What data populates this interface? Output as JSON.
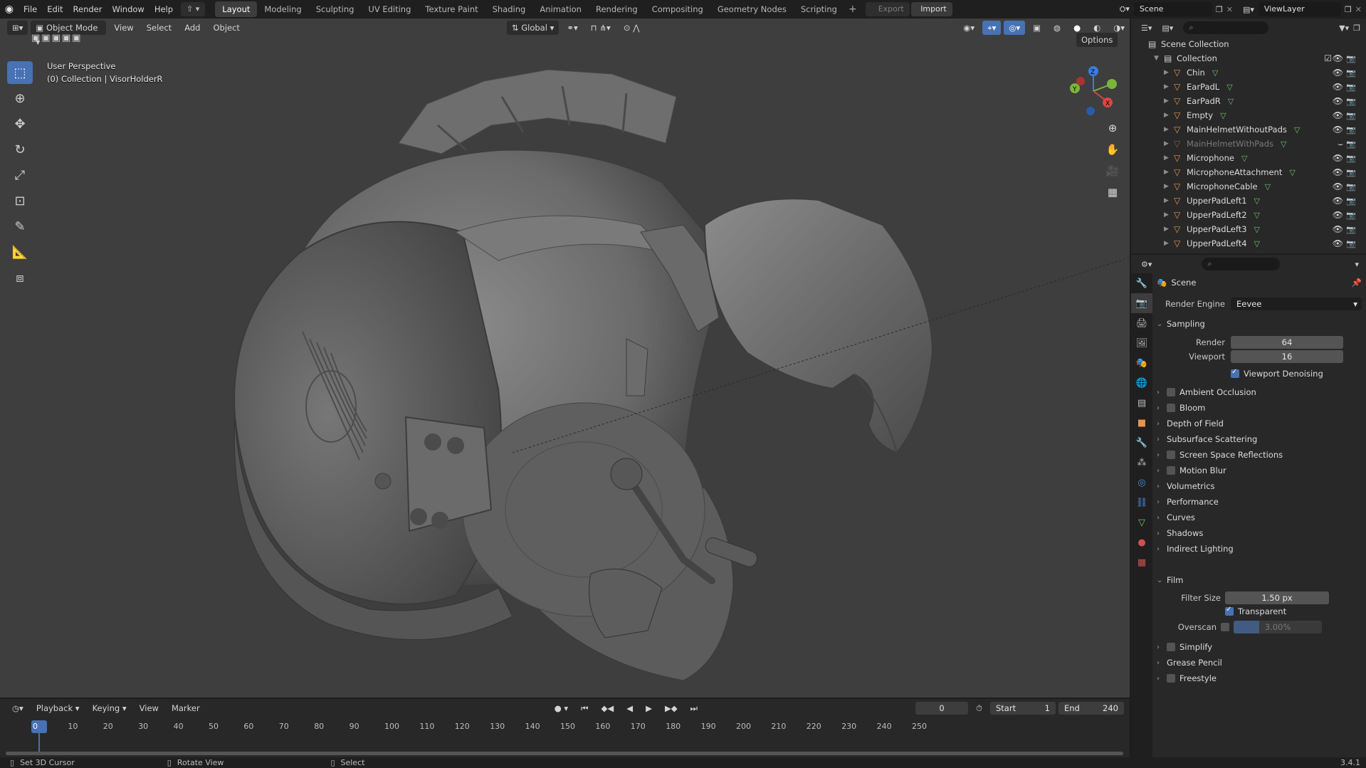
{
  "topbar": {
    "menus": [
      "File",
      "Edit",
      "Render",
      "Window",
      "Help"
    ],
    "workspaces": [
      "Layout",
      "Modeling",
      "Sculpting",
      "UV Editing",
      "Texture Paint",
      "Shading",
      "Animation",
      "Rendering",
      "Compositing",
      "Geometry Nodes",
      "Scripting"
    ],
    "active_workspace": "Layout",
    "export_label": "Export",
    "import_label": "Import",
    "scene_name": "Scene",
    "viewlayer_name": "ViewLayer"
  },
  "viewport": {
    "mode": "Object Mode",
    "menus": [
      "View",
      "Select",
      "Add",
      "Object"
    ],
    "orientation": "Global",
    "options_label": "Options",
    "perspective_label": "User Perspective",
    "collection_label": "(0) Collection | VisorHolderR",
    "gizmo": {
      "x": "X",
      "y": "Y",
      "z": "Z"
    }
  },
  "outliner": {
    "root": "Scene Collection",
    "collection": "Collection",
    "items": [
      {
        "name": "Chin",
        "dim": false
      },
      {
        "name": "EarPadL",
        "dim": false
      },
      {
        "name": "EarPadR",
        "dim": false
      },
      {
        "name": "Empty",
        "dim": false
      },
      {
        "name": "MainHelmetWithoutPads",
        "dim": false
      },
      {
        "name": "MainHelmetWithPads",
        "dim": true
      },
      {
        "name": "Microphone",
        "dim": false
      },
      {
        "name": "MicrophoneAttachment",
        "dim": false
      },
      {
        "name": "MicrophoneCable",
        "dim": false
      },
      {
        "name": "UpperPadLeft1",
        "dim": false
      },
      {
        "name": "UpperPadLeft2",
        "dim": false
      },
      {
        "name": "UpperPadLeft3",
        "dim": false
      },
      {
        "name": "UpperPadLeft4",
        "dim": false
      }
    ]
  },
  "properties": {
    "context": "Scene",
    "render_engine_label": "Render Engine",
    "render_engine": "Eevee",
    "sampling": {
      "label": "Sampling",
      "render_label": "Render",
      "render": "64",
      "viewport_label": "Viewport",
      "viewport": "16",
      "denoise_label": "Viewport Denoising"
    },
    "panels": [
      "Ambient Occlusion",
      "Bloom",
      "Depth of Field",
      "Subsurface Scattering",
      "Screen Space Reflections",
      "Motion Blur",
      "Volumetrics",
      "Performance",
      "Curves",
      "Shadows",
      "Indirect Lighting"
    ],
    "film": {
      "label": "Film",
      "filter_label": "Filter Size",
      "filter": "1.50 px",
      "transparent_label": "Transparent",
      "overscan_label": "Overscan",
      "overscan": "3.00%"
    },
    "bottom_panels": [
      "Simplify",
      "Grease Pencil",
      "Freestyle"
    ]
  },
  "timeline": {
    "menus": [
      "Playback",
      "Keying",
      "View",
      "Marker"
    ],
    "current_frame": "0",
    "start_label": "Start",
    "start": "1",
    "end_label": "End",
    "end": "240",
    "ticks": [
      "0",
      "10",
      "20",
      "30",
      "40",
      "50",
      "60",
      "70",
      "80",
      "90",
      "100",
      "110",
      "120",
      "130",
      "140",
      "150",
      "160",
      "170",
      "180",
      "190",
      "200",
      "210",
      "220",
      "230",
      "240",
      "250"
    ]
  },
  "statusbar": {
    "left": "Set 3D Cursor",
    "middle": "Rotate View",
    "right": "Select",
    "version": "3.4.1"
  }
}
